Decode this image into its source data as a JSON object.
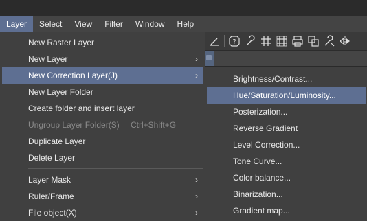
{
  "menubar": {
    "items": [
      {
        "label": "Layer",
        "active": true
      },
      {
        "label": "Select"
      },
      {
        "label": "View"
      },
      {
        "label": "Filter"
      },
      {
        "label": "Window"
      },
      {
        "label": "Help"
      }
    ]
  },
  "toolbar": {
    "icons": [
      "pen-icon",
      "help-icon",
      "wrench-icon",
      "grid-icon",
      "grid-alt-icon",
      "print-icon",
      "transform-icon",
      "settings-wrench-icon",
      "flip-icon"
    ]
  },
  "layer_menu": {
    "items": [
      {
        "label": "New Raster Layer"
      },
      {
        "label": "New Layer",
        "arrow": "›"
      },
      {
        "label": "New Correction Layer(J)",
        "arrow": "›",
        "highlight": true
      },
      {
        "label": "New Layer Folder"
      },
      {
        "label": "Create folder and insert layer"
      },
      {
        "label": "Ungroup Layer Folder(S)",
        "shortcut": "Ctrl+Shift+G",
        "disabled": true
      },
      {
        "label": "Duplicate Layer"
      },
      {
        "label": "Delete Layer"
      },
      {
        "label": "Layer Mask",
        "arrow": "›"
      },
      {
        "label": "Ruler/Frame",
        "arrow": "›"
      },
      {
        "label": "File object(X)",
        "arrow": "›"
      }
    ]
  },
  "correction_submenu": {
    "items": [
      {
        "label": "Brightness/Contrast..."
      },
      {
        "label": "Hue/Saturation/Luminosity...",
        "highlight": true
      },
      {
        "label": "Posterization..."
      },
      {
        "label": "Reverse Gradient"
      },
      {
        "label": "Level Correction..."
      },
      {
        "label": "Tone Curve..."
      },
      {
        "label": "Color balance..."
      },
      {
        "label": "Binarization..."
      },
      {
        "label": "Gradient map..."
      }
    ]
  },
  "colors": {
    "highlight": "#5e6f92",
    "menu_bg": "#404040",
    "text": "#e8e8e8",
    "disabled_text": "#8a8a8a"
  }
}
